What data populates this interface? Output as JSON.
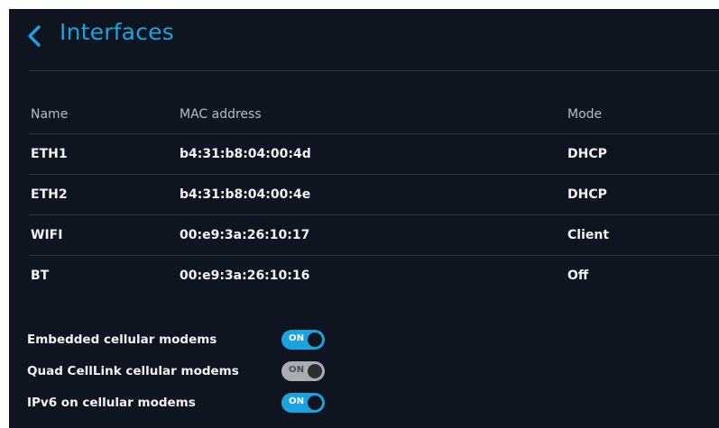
{
  "header": {
    "title": "Interfaces",
    "back_icon": "chevron-left-icon",
    "accent": "#1aa3de"
  },
  "table": {
    "columns": [
      "Name",
      "MAC address",
      "Mode"
    ],
    "rows": [
      {
        "name": "ETH1",
        "mac": "b4:31:b8:04:00:4d",
        "mode": "DHCP"
      },
      {
        "name": "ETH2",
        "mac": "b4:31:b8:04:00:4e",
        "mode": "DHCP"
      },
      {
        "name": "WIFI",
        "mac": "00:e9:3a:26:10:17",
        "mode": "Client"
      },
      {
        "name": "BT",
        "mac": "00:e9:3a:26:10:16",
        "mode": "Off"
      }
    ]
  },
  "toggles": [
    {
      "label": "Embedded cellular modems",
      "state_text": "ON",
      "enabled": true
    },
    {
      "label": "Quad CellLink cellular modems",
      "state_text": "ON",
      "enabled": false
    },
    {
      "label": "IPv6 on cellular modems",
      "state_text": "ON",
      "enabled": true
    }
  ],
  "colors": {
    "background": "#0f1421",
    "toggle_on": "#1aa3de",
    "toggle_off": "#a9acb1"
  }
}
